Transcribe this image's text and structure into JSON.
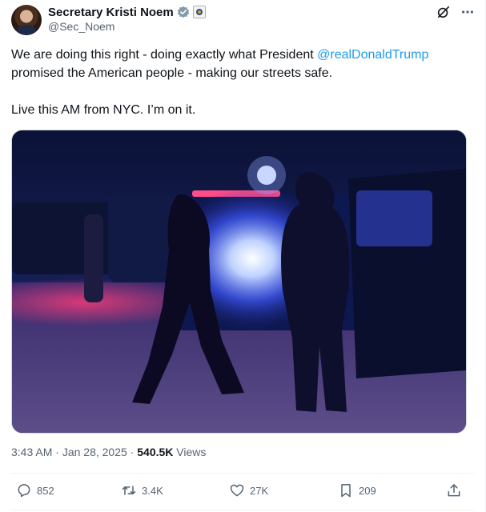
{
  "author": {
    "name": "Secretary Kristi Noem",
    "handle": "@Sec_Noem"
  },
  "header_icons": [
    "grok-icon",
    "more-icon"
  ],
  "tweet": {
    "line1_before": "We are doing this right - doing exactly what President ",
    "mention": "@realDonaldTrump",
    "line1_after": "promised the American people - making our streets safe.",
    "line2": "Live this AM from NYC. I’m on it."
  },
  "meta": {
    "time": "3:43 AM",
    "sep1": " · ",
    "date": "Jan 28, 2025",
    "sep2": " · ",
    "views": "540.5K",
    "views_label": " Views"
  },
  "actions": {
    "replies": "852",
    "reposts": "3.4K",
    "likes": "27K",
    "bookmarks": "209"
  },
  "colors": {
    "link": "#1d9bf0",
    "secondary_text": "#536471",
    "verified": "#829aab"
  }
}
